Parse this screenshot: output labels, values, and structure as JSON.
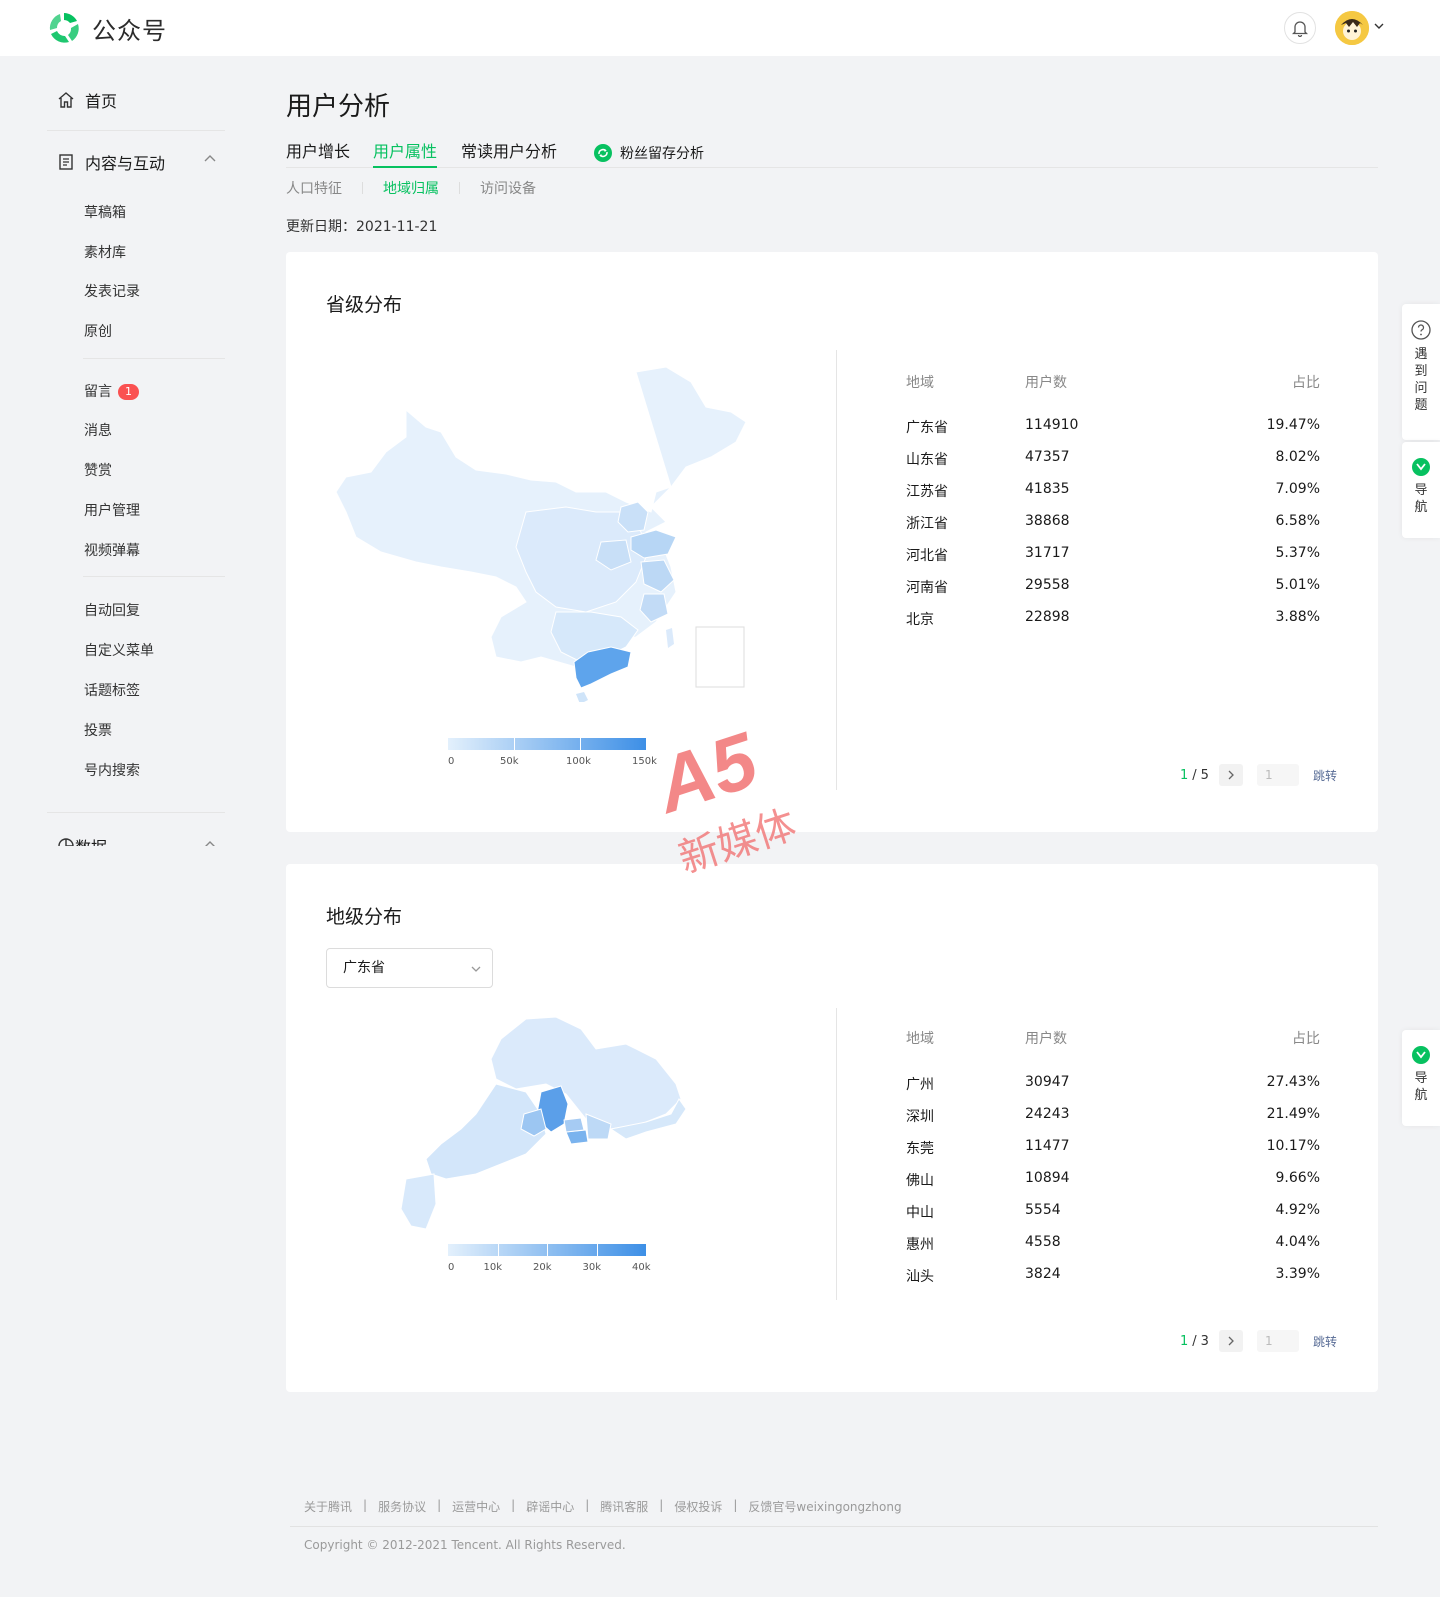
{
  "header": {
    "brand": "公众号"
  },
  "sidebar": {
    "home": "首页",
    "group_content": "内容与互动",
    "items_a": [
      "草稿箱",
      "素材库",
      "发表记录",
      "原创"
    ],
    "items_b": [
      {
        "label": "留言",
        "badge": "1"
      },
      {
        "label": "消息"
      },
      {
        "label": "赞赏"
      },
      {
        "label": "用户管理"
      },
      {
        "label": "视频弹幕"
      }
    ],
    "items_c": [
      "自动回复",
      "自定义菜单",
      "话题标签",
      "投票",
      "号内搜索"
    ],
    "group_data": "数据"
  },
  "main": {
    "title": "用户分析",
    "tabs": [
      "用户增长",
      "用户属性",
      "常读用户分析",
      "粉丝留存分析"
    ],
    "active_tab": "用户属性",
    "subtabs": [
      "人口特征",
      "地域归属",
      "访问设备"
    ],
    "active_subtab": "地域归属",
    "update_label": "更新日期：",
    "update_date": "2021-11-21"
  },
  "province_card": {
    "title": "省级分布",
    "columns": [
      "地域",
      "用户数",
      "占比"
    ],
    "rows": [
      {
        "region": "广东省",
        "users": "114910",
        "ratio": "19.47%"
      },
      {
        "region": "山东省",
        "users": "47357",
        "ratio": "8.02%"
      },
      {
        "region": "江苏省",
        "users": "41835",
        "ratio": "7.09%"
      },
      {
        "region": "浙江省",
        "users": "38868",
        "ratio": "6.58%"
      },
      {
        "region": "河北省",
        "users": "31717",
        "ratio": "5.37%"
      },
      {
        "region": "河南省",
        "users": "29558",
        "ratio": "5.01%"
      },
      {
        "region": "北京",
        "users": "22898",
        "ratio": "3.88%"
      }
    ],
    "legend": [
      "0",
      "50k",
      "100k",
      "150k"
    ],
    "pager": {
      "current": "1",
      "sep": "/",
      "total": "5",
      "input": "1",
      "jump": "跳转"
    }
  },
  "city_card": {
    "title": "地级分布",
    "select_value": "广东省",
    "columns": [
      "地域",
      "用户数",
      "占比"
    ],
    "rows": [
      {
        "region": "广州",
        "users": "30947",
        "ratio": "27.43%"
      },
      {
        "region": "深圳",
        "users": "24243",
        "ratio": "21.49%"
      },
      {
        "region": "东莞",
        "users": "11477",
        "ratio": "10.17%"
      },
      {
        "region": "佛山",
        "users": "10894",
        "ratio": "9.66%"
      },
      {
        "region": "中山",
        "users": "5554",
        "ratio": "4.92%"
      },
      {
        "region": "惠州",
        "users": "4558",
        "ratio": "4.04%"
      },
      {
        "region": "汕头",
        "users": "3824",
        "ratio": "3.39%"
      }
    ],
    "legend": [
      "0",
      "10k",
      "20k",
      "30k",
      "40k"
    ],
    "pager": {
      "current": "1",
      "sep": "/",
      "total": "3",
      "input": "1",
      "jump": "跳转"
    }
  },
  "float": {
    "help": "遇到问题",
    "nav": "导航"
  },
  "watermark": {
    "logo": "A5",
    "text": "新媒体"
  },
  "footer": {
    "links": [
      "关于腾讯",
      "服务协议",
      "运营中心",
      "辟谣中心",
      "腾讯客服",
      "侵权投诉",
      "反馈官号weixingongzhong"
    ],
    "copyright": "Copyright © 2012-2021 Tencent. All Rights Reserved."
  },
  "colors": {
    "brand_green": "#07c160",
    "map_low": "#e3f0fc",
    "map_high": "#3d8fe6",
    "badge_red": "#fa5151"
  }
}
